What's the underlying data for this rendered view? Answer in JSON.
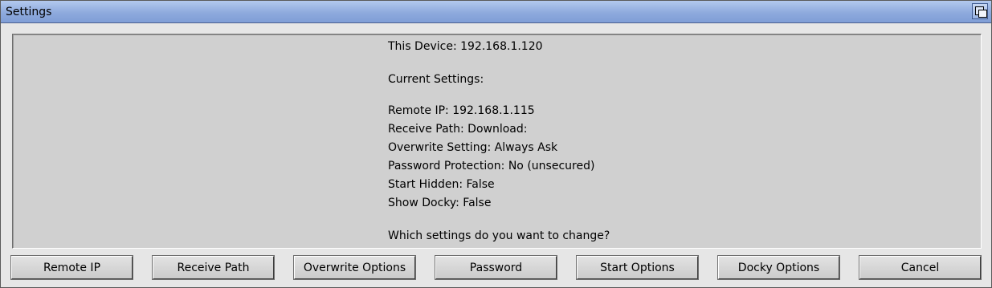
{
  "window": {
    "title": "Settings",
    "depth_gadget_icon": "window-depth-icon"
  },
  "info": {
    "device": "This Device: 192.168.1.120",
    "current_heading": "Current Settings:",
    "remote_ip": "Remote IP: 192.168.1.115",
    "receive_path": "Receive Path: Download:",
    "overwrite": "Overwrite Setting: Always Ask",
    "password": "Password Protection: No (unsecured)",
    "start_hidden": "Start Hidden: False",
    "show_docky": "Show Docky: False",
    "question": "Which settings do you want to change?"
  },
  "buttons": {
    "remote_ip": "Remote IP",
    "receive_path": "Receive Path",
    "overwrite_options": "Overwrite Options",
    "password": "Password",
    "start_options": "Start Options",
    "docky_options": "Docky Options",
    "cancel": "Cancel"
  },
  "colors": {
    "titlebar": "#8eaadd",
    "panel": "#d0d0d0",
    "window": "#e6e6e6"
  }
}
